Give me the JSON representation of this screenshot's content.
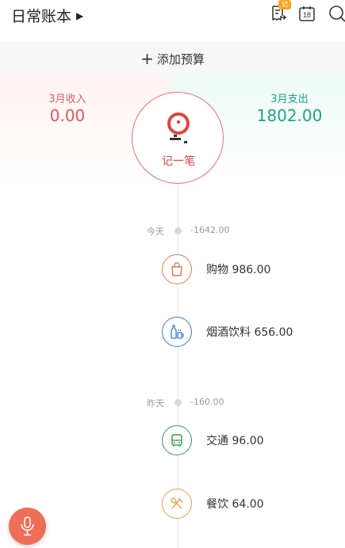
{
  "header": {
    "ledger_name": "日常账本",
    "caret": "▶",
    "bill_icon": "bill-list-icon",
    "bill_badge": "记",
    "calendar_icon": "calendar-icon",
    "calendar_day": "18",
    "search_icon": "search-icon"
  },
  "budget": {
    "plus": "+",
    "label": "添加预算"
  },
  "summary": {
    "income_label": "3月收入",
    "income_value": "0.00",
    "expense_label": "3月支出",
    "expense_value": "1802.00",
    "income_color": "#e05a5a",
    "expense_color": "#1aa58a"
  },
  "record_button": {
    "label": "记一笔",
    "icon": "record-pen-icon",
    "color": "#e0443e"
  },
  "days": [
    {
      "label": "今天",
      "total": "-1642.00",
      "entries": [
        {
          "text": "购物 986.00",
          "icon": "shopping-bag-icon",
          "color": "#e07a4f"
        },
        {
          "text": "烟酒饮料 656.00",
          "icon": "drink-bottle-icon",
          "color": "#3a7fd0"
        }
      ]
    },
    {
      "label": "昨天",
      "total": "-160.00",
      "entries": [
        {
          "text": "交通 96.00",
          "icon": "bus-icon",
          "color": "#3a9a4a"
        },
        {
          "text": "餐饮 64.00",
          "icon": "dining-icon",
          "color": "#e8a23a"
        }
      ]
    }
  ],
  "mic_button": {
    "icon": "microphone-icon",
    "color": "#ee6e57"
  }
}
